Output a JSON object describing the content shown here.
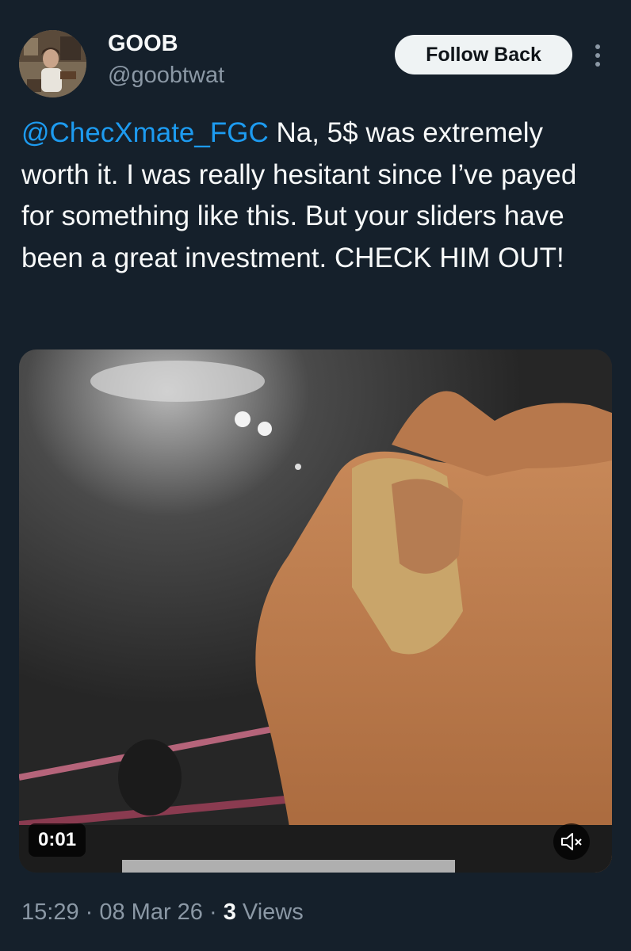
{
  "author": {
    "display_name": "GOOB",
    "handle": "@goobtwat",
    "avatar_icon": "profile-photo"
  },
  "actions": {
    "follow_back_label": "Follow Back",
    "more_icon": "more-vertical-icon"
  },
  "tweet": {
    "mention": "@ChecXmate_FGC",
    "body": " Na, 5$ was extremely worth it. I was really hesitant since I’ve payed for something like this. But your sliders have been a great investment. CHECK HIM OUT!"
  },
  "video": {
    "elapsed": "0:01",
    "mute_icon": "volume-muted-icon"
  },
  "meta": {
    "time": "15:29",
    "separator": " · ",
    "date": "08 Mar 26",
    "views_count": "3",
    "views_label": " Views"
  },
  "colors": {
    "background": "#15202b",
    "text": "#f7f9f9",
    "secondary": "#8b98a5",
    "link": "#1d9bf0",
    "button_bg": "#eff3f4"
  }
}
